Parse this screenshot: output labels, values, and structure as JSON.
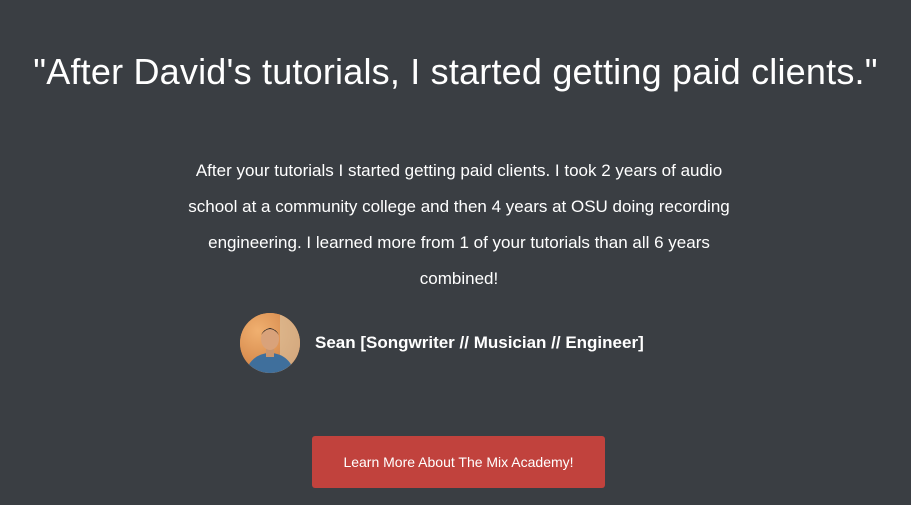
{
  "testimonial": {
    "headline": "\"After David's tutorials, I started getting paid clients.\"",
    "body": "After your tutorials I started getting paid clients. I took 2 years of audio school at a community college and then 4 years at OSU doing recording engineering. I learned more from 1 of your tutorials than all 6 years combined!",
    "author_name": "Sean [Songwriter // Musician // Engineer]",
    "avatar": "person-photo"
  },
  "cta": {
    "label": "Learn More About The Mix Academy!",
    "color": "#c1423d"
  },
  "colors": {
    "background": "#3a3e43",
    "text": "#ffffff"
  }
}
